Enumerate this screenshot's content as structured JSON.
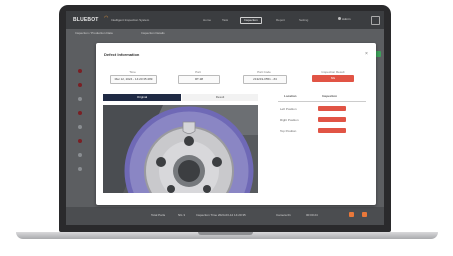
{
  "header": {
    "logo": "BLUEBOT",
    "app_name": "Intelligent Inspection System",
    "nav": [
      "Home",
      "Task",
      "Inspection",
      "Report",
      "Setting"
    ],
    "user": "Admin"
  },
  "breadcrumb": [
    "Inspection / Production Data",
    "Inspection Details"
  ],
  "modal": {
    "title": "Defect Information",
    "close": "×",
    "fields": [
      {
        "label": "Time",
        "value": "Mar 12, 2024 - 14:20:35:489"
      },
      {
        "label": "Part",
        "value": "RT-98"
      },
      {
        "label": "Part Code",
        "value": "213219-0551 - #4"
      },
      {
        "label": "Inspection Result",
        "value": "NG"
      }
    ],
    "tabs": [
      "Original",
      "Result"
    ],
    "table_headers": [
      "Location",
      "Inspection"
    ],
    "table_rows": [
      "Left Position",
      "Right Position",
      "Top Position"
    ]
  },
  "footer": {
    "items": [
      "Total Parts",
      "NG 3",
      "Inspection Time 2024-03-12 14:20:35",
      "Camera 01",
      "00:00:24"
    ]
  },
  "colors": {
    "accent_red": "#e15445",
    "tab_active": "#1f2a44",
    "brake_disc_band": "#7c74c8"
  }
}
